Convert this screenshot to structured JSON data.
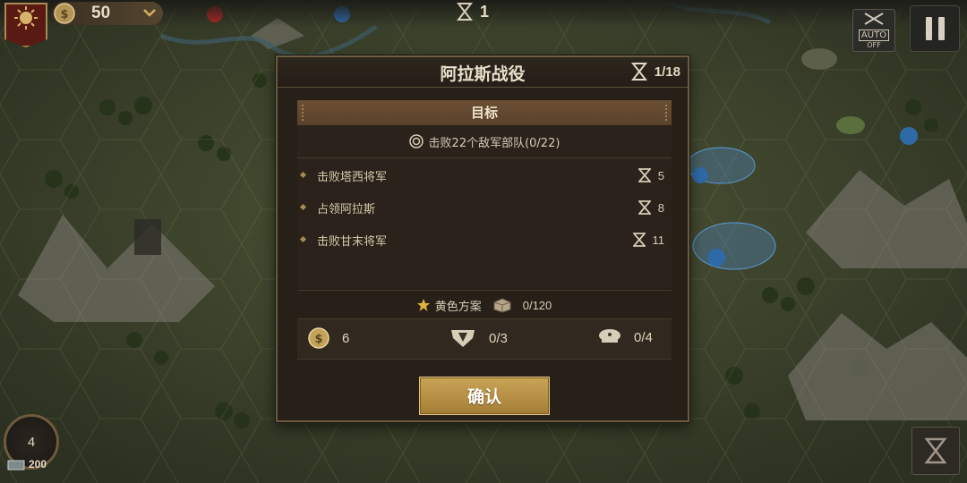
{
  "hud": {
    "coins": "50",
    "turn_counter": "1",
    "auto_label": "AUTO",
    "auto_state": "OFF",
    "reinforce_count": "4",
    "supply_count": "200"
  },
  "dialog": {
    "title": "阿拉斯战役",
    "turns": "1/18",
    "objectives_header": "目标",
    "main_objective": "击败22个敌军部队(0/22)",
    "objectives": [
      {
        "label": "击败塔西将军",
        "reward_turns": "5"
      },
      {
        "label": "占领阿拉斯",
        "reward_turns": "8"
      },
      {
        "label": "击败甘末将军",
        "reward_turns": "11"
      }
    ],
    "yellow_plan_label": "黄色方案",
    "yellow_plan_count": "0/120",
    "rewards": {
      "coins": "6",
      "medals": "0/3",
      "generals": "0/4"
    },
    "confirm_label": "确认"
  },
  "colors": {
    "panel_bg": "#262019",
    "border_gold": "#6b5b40",
    "button_gold": "#c9a356",
    "objective_header": "#6b4f34"
  },
  "icons": [
    "sun-emblem-icon",
    "coin-icon",
    "chevron-down-icon",
    "hourglass-icon",
    "pause-icon",
    "auto-rifles-icon",
    "target-icon",
    "star-icon",
    "crate-icon",
    "medal-icon",
    "general-cap-icon"
  ]
}
